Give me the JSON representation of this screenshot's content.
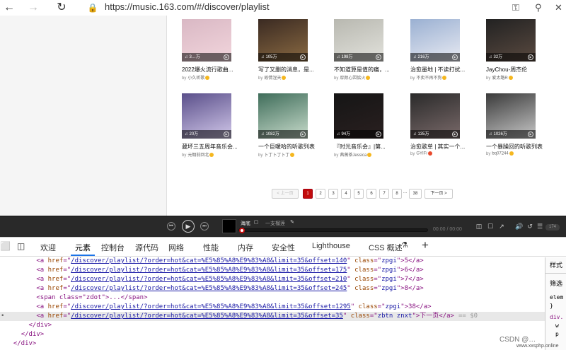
{
  "browser": {
    "back_icon": "arrow-left-icon",
    "forward_icon": "arrow-right-icon",
    "reload_icon": "reload-icon",
    "lock_icon": "lock-icon",
    "url": "https://music.163.com/#/discover/playlist",
    "key_icon": "key-icon",
    "zoom_icon": "magnifier-icon",
    "close_icon": "close-icon"
  },
  "playlists": [
    {
      "title": "2022爆火流行歌曲...",
      "by": "by",
      "author": "小久听歌",
      "plays": "3…万",
      "colors": [
        "#d9b8c4",
        "#f2d5dc"
      ]
    },
    {
      "title": "写了又删的消息，是...",
      "by": "by",
      "author": "故情涅天",
      "plays": "105万",
      "colors": [
        "#3a2a22",
        "#8a6a42"
      ]
    },
    {
      "title": "不知道算是值的痛，...",
      "by": "by",
      "author": "厚颜心因惦火",
      "plays": "198万",
      "colors": [
        "#b8b8b0",
        "#e2e2dc"
      ]
    },
    {
      "title": "治愈墨地 | 不读打扰...",
      "by": "by",
      "author": "不卖不再不狗",
      "plays": "216万",
      "colors": [
        "#9ab0d2",
        "#e8eaf2"
      ]
    },
    {
      "title": "JayChou-周杰伦",
      "by": "by",
      "author": "爱太路R",
      "plays": "32万",
      "colors": [
        "#222",
        "#5a4a40"
      ]
    },
    {
      "title": "葳坏三五周年音乐会...",
      "by": "by",
      "author": "元翱前回北",
      "plays": "20万",
      "colors": [
        "#5a4f8a",
        "#d2c8ea"
      ]
    },
    {
      "title": "一个巨暖哈的听歌列表",
      "by": "by",
      "author": "卜丁卜丁卜丁",
      "plays": "1082万",
      "colors": [
        "#3f6d5a",
        "#c9dccc"
      ]
    },
    {
      "title": "『时光音乐会』|第...",
      "by": "by",
      "author": "茜薇茶Jessica",
      "plays": "94万",
      "colors": [
        "#151515",
        "#2a2020"
      ]
    },
    {
      "title": "治愈歌单 | 其实一个...",
      "by": "by",
      "author": "GYIFi",
      "plays": "135万",
      "colors": [
        "#2a2a2a",
        "#7a6a6a"
      ]
    },
    {
      "title": "一个暴躁回的听歌列表",
      "by": "by",
      "author": "bq07244",
      "plays": "1026万",
      "colors": [
        "#3a3a3a",
        "#c8c8c8"
      ]
    }
  ],
  "pagination": {
    "prev": "< 上一页",
    "pages": [
      "1",
      "2",
      "3",
      "4",
      "5",
      "6",
      "7",
      "8"
    ],
    "ellipsis": "...",
    "last": "38",
    "next": "下一页 >"
  },
  "player": {
    "prev_icon": "prev-icon",
    "play_icon": "play-icon",
    "next_icon": "next-icon",
    "song": "海底",
    "mv_icon": "mv-icon",
    "artist": "一支榴莲",
    "share_icon": "share-icon",
    "time": "00:00 / 00:00",
    "count": "174",
    "progress": 0.0
  },
  "devtools": {
    "tabs": [
      "欢迎",
      "元素",
      "控制台",
      "源代码",
      "网络",
      "性能",
      "内存",
      "安全性",
      "Lighthouse",
      "CSS 概述"
    ],
    "active_tab": "元素",
    "code": [
      {
        "indent": "        ",
        "tag_open": "<a href=\"",
        "href": "/discover/playlist/?order=hot&cat=%E5%85%A8%E9%83%A8&limit=35&offset=140",
        "mid": "\" class=\"",
        "cls": "zpgi",
        "tail": "\">5</a>"
      },
      {
        "indent": "        ",
        "tag_open": "<a href=\"",
        "href": "/discover/playlist/?order=hot&cat=%E5%85%A8%E9%83%A8&limit=35&offset=175",
        "mid": "\" class=\"",
        "cls": "zpgi",
        "tail": "\">6</a>"
      },
      {
        "indent": "        ",
        "tag_open": "<a href=\"",
        "href": "/discover/playlist/?order=hot&cat=%E5%85%A8%E9%83%A8&limit=35&offset=210",
        "mid": "\" class=\"",
        "cls": "zpgi",
        "tail": "\">7</a>"
      },
      {
        "indent": "        ",
        "tag_open": "<a href=\"",
        "href": "/discover/playlist/?order=hot&cat=%E5%85%A8%E9%83%A8&limit=35&offset=245",
        "mid": "\" class=\"",
        "cls": "zpgi",
        "tail": "\">8</a>"
      },
      {
        "indent": "        ",
        "span": "<span class=\"zdot\">...</span>"
      },
      {
        "indent": "        ",
        "tag_open": "<a href=\"",
        "href": "/discover/playlist/?order=hot&cat=%E5%85%A8%E9%83%A8&limit=35&offset=1295",
        "mid": "\" class=\"",
        "cls": "zpgi",
        "tail": "\">38</a>"
      },
      {
        "indent": "        ",
        "tag_open": "<a href=\"",
        "href": "/discover/playlist/?order=hot&cat=%E5%85%A8%E9%83%A8&limit=35&offset=35",
        "mid": "\" class=\"",
        "cls": "zbtn znxt",
        "tail": "\">下一页</a>",
        "dollar": "== $0"
      },
      {
        "indent": "      ",
        "close": "</div>"
      },
      {
        "indent": "    ",
        "close": "</div>"
      },
      {
        "indent": "  ",
        "close": "</div>"
      }
    ],
    "styles_tab": "样式",
    "styles_lines": [
      "筛选",
      "elem",
      "}",
      "div.",
      "w",
      "p"
    ]
  },
  "watermark": "CSDN @…",
  "watermark_url": "www.xxsphp.online"
}
